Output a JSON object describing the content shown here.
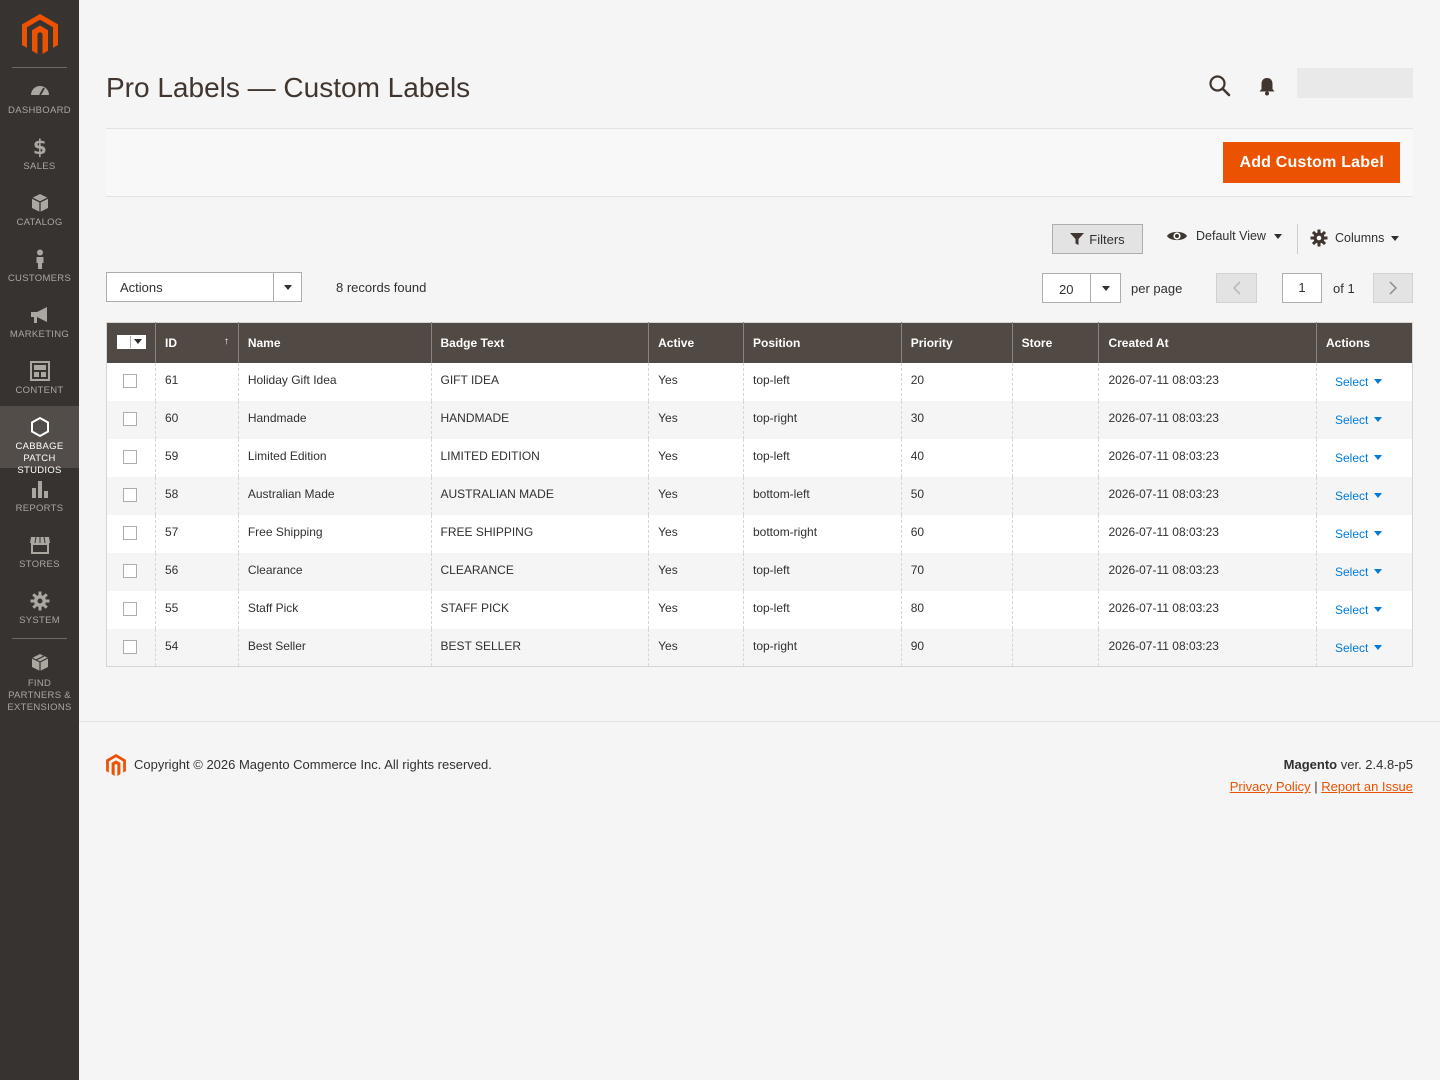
{
  "sidebar": {
    "items": [
      {
        "label": "DASHBOARD",
        "icon": "speedometer-icon"
      },
      {
        "label": "SALES",
        "icon": "dollar-icon"
      },
      {
        "label": "CATALOG",
        "icon": "cube-icon"
      },
      {
        "label": "CUSTOMERS",
        "icon": "person-icon"
      },
      {
        "label": "MARKETING",
        "icon": "megaphone-icon"
      },
      {
        "label": "CONTENT",
        "icon": "content-icon"
      },
      {
        "label": "CABBAGE PATCH STUDIOS",
        "icon": "hexagon-icon"
      },
      {
        "label": "REPORTS",
        "icon": "bar-chart-icon"
      },
      {
        "label": "STORES",
        "icon": "storefront-icon"
      },
      {
        "label": "SYSTEM",
        "icon": "gear-icon"
      },
      {
        "label": "FIND PARTNERS & EXTENSIONS",
        "icon": "boxes-icon"
      }
    ],
    "active_index": 6
  },
  "header": {
    "title": "Pro Labels — Custom Labels"
  },
  "page_actions": {
    "add_label": "Add Custom Label"
  },
  "toolbar": {
    "filters": "Filters",
    "default_view": "Default View",
    "columns": "Columns",
    "actions": "Actions",
    "records_found": "8 records found",
    "per_page_value": "20",
    "per_page_label": "per page",
    "page_current": "1",
    "page_of": "of 1"
  },
  "grid": {
    "columns": [
      "ID",
      "Name",
      "Badge Text",
      "Active",
      "Position",
      "Priority",
      "Store",
      "Created At",
      "Actions"
    ],
    "sort_indicator": "↑",
    "rows": [
      {
        "id": "61",
        "name": "Holiday Gift Idea",
        "badge": "GIFT IDEA",
        "active": "Yes",
        "position": "top-left",
        "priority": "20",
        "store": "",
        "created": "2026-07-11 08:03:23",
        "action": "Select"
      },
      {
        "id": "60",
        "name": "Handmade",
        "badge": "HANDMADE",
        "active": "Yes",
        "position": "top-right",
        "priority": "30",
        "store": "",
        "created": "2026-07-11 08:03:23",
        "action": "Select"
      },
      {
        "id": "59",
        "name": "Limited Edition",
        "badge": "LIMITED EDITION",
        "active": "Yes",
        "position": "top-left",
        "priority": "40",
        "store": "",
        "created": "2026-07-11 08:03:23",
        "action": "Select"
      },
      {
        "id": "58",
        "name": "Australian Made",
        "badge": "AUSTRALIAN MADE",
        "active": "Yes",
        "position": "bottom-left",
        "priority": "50",
        "store": "",
        "created": "2026-07-11 08:03:23",
        "action": "Select"
      },
      {
        "id": "57",
        "name": "Free Shipping",
        "badge": "FREE SHIPPING",
        "active": "Yes",
        "position": "bottom-right",
        "priority": "60",
        "store": "",
        "created": "2026-07-11 08:03:23",
        "action": "Select"
      },
      {
        "id": "56",
        "name": "Clearance",
        "badge": "CLEARANCE",
        "active": "Yes",
        "position": "top-left",
        "priority": "70",
        "store": "",
        "created": "2026-07-11 08:03:23",
        "action": "Select"
      },
      {
        "id": "55",
        "name": "Staff Pick",
        "badge": "STAFF PICK",
        "active": "Yes",
        "position": "top-left",
        "priority": "80",
        "store": "",
        "created": "2026-07-11 08:03:23",
        "action": "Select"
      },
      {
        "id": "54",
        "name": "Best Seller",
        "badge": "BEST SELLER",
        "active": "Yes",
        "position": "top-right",
        "priority": "90",
        "store": "",
        "created": "2026-07-11 08:03:23",
        "action": "Select"
      }
    ]
  },
  "footer": {
    "copyright": "Copyright © 2026 Magento Commerce Inc. All rights reserved.",
    "brand": "Magento",
    "version": " ver. 2.4.8-p5",
    "privacy": "Privacy Policy",
    "separator": " | ",
    "report": "Report an Issue"
  },
  "colors": {
    "accent": "#eb5202",
    "sidebar_bg": "#373330",
    "grid_header": "#514943",
    "link": "#007bdb"
  }
}
